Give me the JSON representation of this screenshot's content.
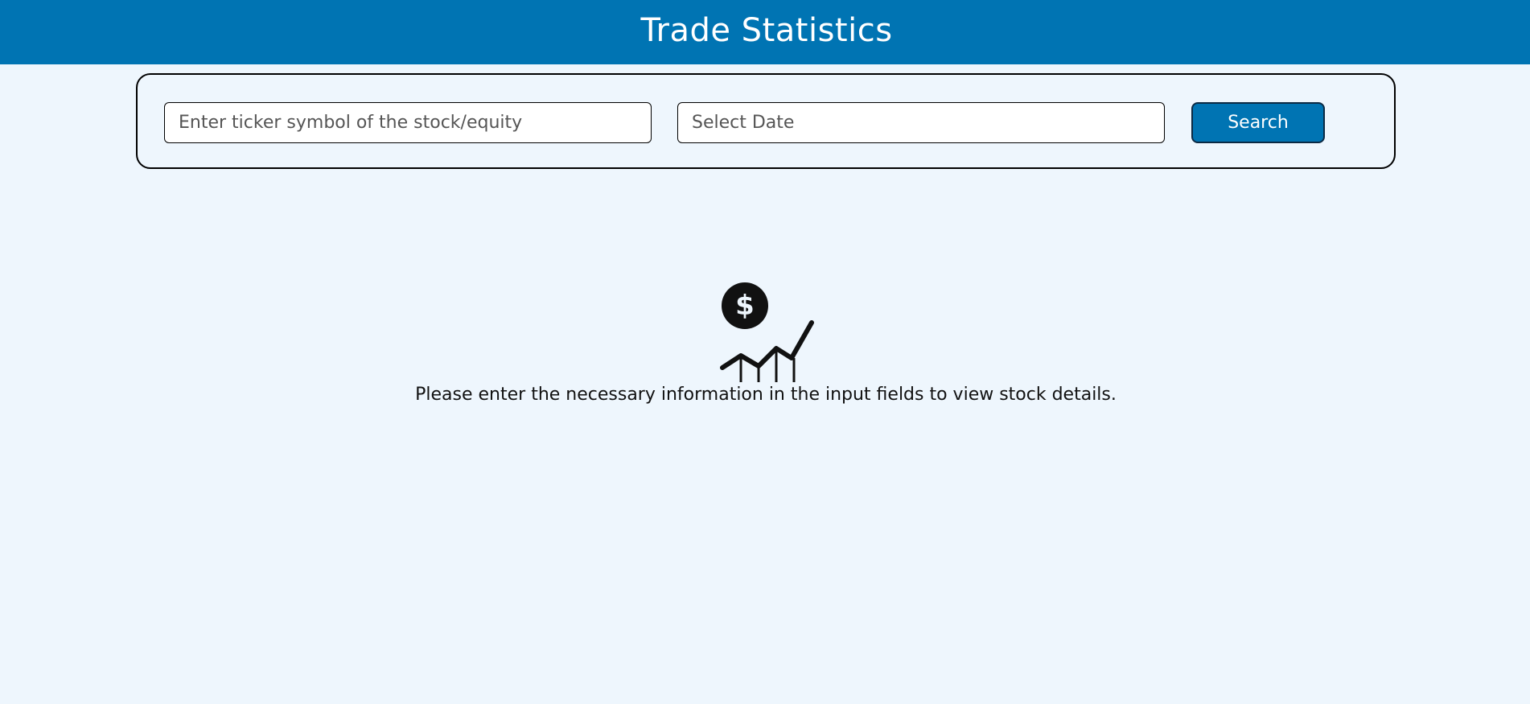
{
  "header": {
    "title": "Trade Statistics"
  },
  "search": {
    "ticker_placeholder": "Enter ticker symbol of the stock/equity",
    "ticker_value": "",
    "date_placeholder": "Select Date",
    "date_value": "",
    "button_label": "Search"
  },
  "empty_state": {
    "icon": "dollar-growth-chart-icon",
    "message": "Please enter the necessary information in the input fields to view stock details."
  },
  "colors": {
    "header_bg": "#0074b3",
    "page_bg": "#eef6fd",
    "button_bg": "#0074b3",
    "icon": "#111111"
  }
}
